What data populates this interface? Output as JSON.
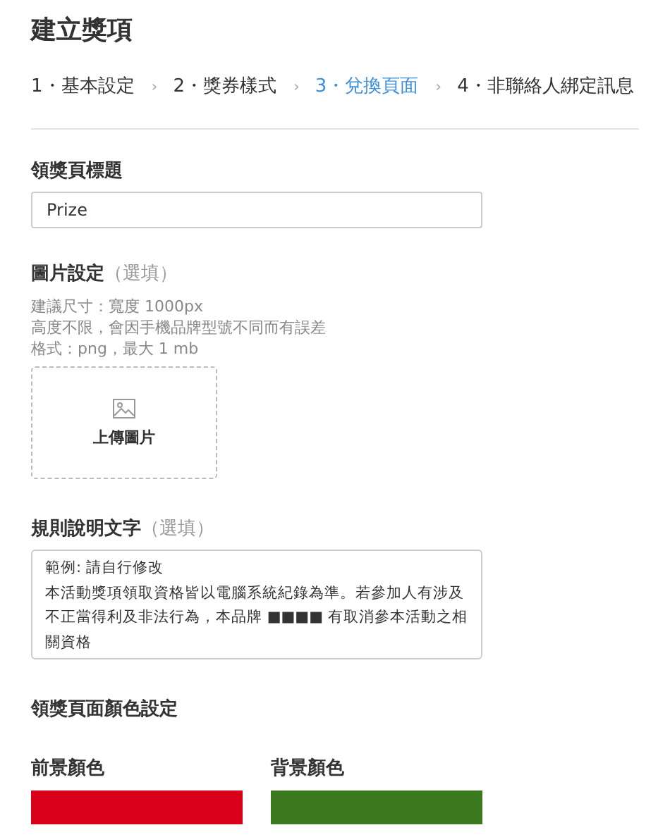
{
  "title": "建立獎項",
  "steps": [
    {
      "label": "1・基本設定",
      "selected": false
    },
    {
      "label": "2・獎券樣式",
      "selected": false
    },
    {
      "label": "3・兌換頁面",
      "selected": true
    },
    {
      "label": "4・非聯絡人綁定訊息",
      "selected": false
    }
  ],
  "step_separator": "›",
  "prize_title": {
    "label": "領獎頁標題",
    "value": "Prize"
  },
  "image": {
    "label": "圖片設定",
    "optional": "（選填）",
    "hints": [
      "建議尺寸：寬度 1000px",
      "高度不限，會因手機品牌型號不同而有誤差",
      "格式：png，最大 1 mb"
    ],
    "upload": "上傳圖片"
  },
  "rules": {
    "label": "規則說明文字",
    "optional": "（選填）",
    "lines": [
      "範例: 請自行修改",
      "本活動獎項領取資格皆以電腦系統紀錄為準。若參加人有涉及不正當得利及非法行為，本品牌 ■■■■ 有取消參本活動之相關資格"
    ]
  },
  "colors": {
    "label": "領獎頁面顏色設定",
    "items": [
      {
        "label": "前景顏色",
        "color": "#d9001b"
      },
      {
        "label": "背景顏色",
        "color": "#3d7a1f"
      }
    ]
  }
}
